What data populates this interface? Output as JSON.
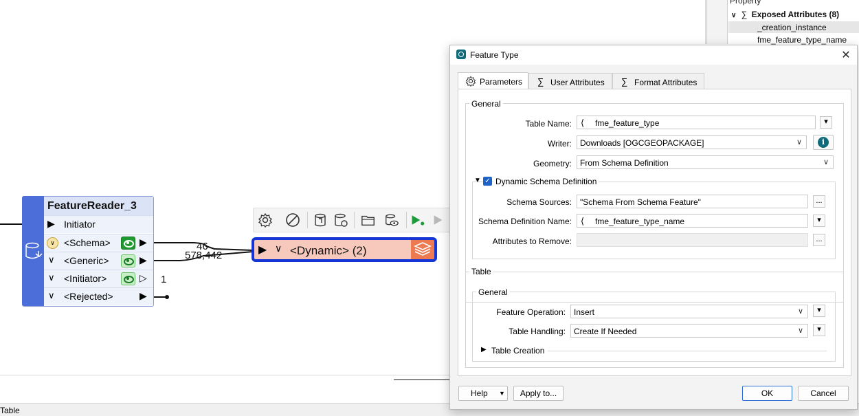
{
  "property_panel": {
    "header": "Property",
    "group_label": "Exposed Attributes (8)",
    "rows": [
      "_creation_instance",
      "fme_feature_type_name"
    ]
  },
  "feature_reader": {
    "title": "FeatureReader_3",
    "input_port": "Initiator",
    "ports": [
      {
        "label": "<Schema>",
        "count": "46"
      },
      {
        "label": "<Generic>",
        "count": "578,442"
      },
      {
        "label": "<Initiator>",
        "count": "1"
      },
      {
        "label": "<Rejected>",
        "count": ""
      }
    ]
  },
  "writer_node": {
    "label": "<Dynamic> (2)"
  },
  "status_bar": {
    "label": "Table"
  },
  "dialog": {
    "title": "Feature Type",
    "tabs": [
      "Parameters",
      "User Attributes",
      "Format Attributes"
    ],
    "general_group": "General",
    "table_name_label": "Table Name:",
    "table_name_value": "fme_feature_type",
    "writer_label": "Writer:",
    "writer_value": "Downloads [OGCGEOPACKAGE]",
    "geometry_label": "Geometry:",
    "geometry_value": "From Schema Definition",
    "dynamic_schema_label": "Dynamic Schema Definition",
    "schema_sources_label": "Schema Sources:",
    "schema_sources_value": "\"Schema From Schema Feature\"",
    "schema_def_name_label": "Schema Definition Name:",
    "schema_def_name_value": "fme_feature_type_name",
    "attrs_remove_label": "Attributes to Remove:",
    "attrs_remove_value": "",
    "table_group": "Table",
    "table_general_group": "General",
    "feature_operation_label": "Feature Operation:",
    "feature_operation_value": "Insert",
    "table_handling_label": "Table Handling:",
    "table_handling_value": "Create If Needed",
    "table_creation_label": "Table Creation",
    "help_button": "Help",
    "apply_to_button": "Apply to...",
    "ok_button": "OK",
    "cancel_button": "Cancel",
    "ellipsis": "...",
    "dropdown_glyph": "▾",
    "close_glyph": "✕"
  },
  "colors": {
    "reader_band": "#4b6ed8",
    "writer_border": "#1534d6",
    "writer_fill": "#f7c9bd",
    "writer_layers": "#ee7a51",
    "eye_green": "#1f9a2f",
    "ok_border": "#2d6ed5"
  }
}
